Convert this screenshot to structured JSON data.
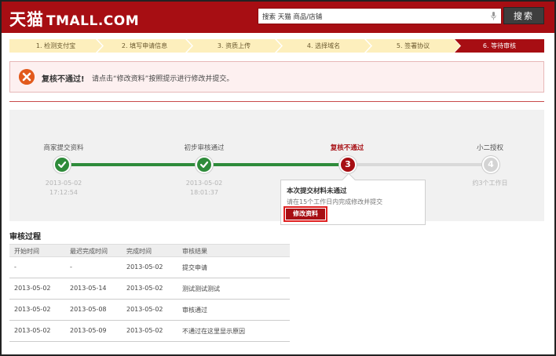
{
  "header": {
    "logo_cn": "天猫",
    "logo_en": "TMALL.COM",
    "search_value": "搜索 天猫 商品/店铺",
    "search_button": "搜索",
    "mic_icon": "microphone-icon"
  },
  "steps": [
    {
      "label": "1. 检测支付宝",
      "state": "done"
    },
    {
      "label": "2. 填写申请信息",
      "state": "done"
    },
    {
      "label": "3. 资质上传",
      "state": "done"
    },
    {
      "label": "4. 选择域名",
      "state": "done"
    },
    {
      "label": "5. 签署协议",
      "state": "done"
    },
    {
      "label": "6. 等待审核",
      "state": "current"
    }
  ],
  "error": {
    "icon": "error-x-icon",
    "title": "复核不通过!",
    "message": "请点击“修改资料”按照提示进行修改并提交。"
  },
  "progress": {
    "stages": [
      {
        "label": "商家提交资料",
        "node": "✓",
        "status": "done",
        "date": "2013-05-02",
        "time": "17:12:54"
      },
      {
        "label": "初步审核通过",
        "node": "✓",
        "status": "done",
        "date": "2013-05-02",
        "time": "18:01:37"
      },
      {
        "label": "复核不通过",
        "node": "3",
        "status": "failed",
        "date": "",
        "time": ""
      },
      {
        "label": "小二授权",
        "node": "4",
        "status": "pending",
        "date": "约3个工作日",
        "time": ""
      }
    ],
    "popup": {
      "title": "本次提交材料未通过",
      "text": "请在15个工作日内完成修改并提交",
      "button": "修改资料"
    },
    "colors": {
      "done": "#2e8b3a",
      "failed": "#a70e13",
      "pending": "#d4d4d4"
    }
  },
  "audit": {
    "title": "审核过程",
    "headers": [
      "开始时间",
      "最迟完成时间",
      "完成时间",
      "审核结果"
    ],
    "rows": [
      [
        "-",
        "-",
        "2013-05-02",
        "提交申请"
      ],
      [
        "2013-05-02",
        "2013-05-14",
        "2013-05-02",
        "测试测试测试"
      ],
      [
        "2013-05-02",
        "2013-05-08",
        "2013-05-02",
        "审核通过"
      ],
      [
        "2013-05-02",
        "2013-05-09",
        "2013-05-02",
        "不通过在这里显示原因"
      ]
    ]
  }
}
